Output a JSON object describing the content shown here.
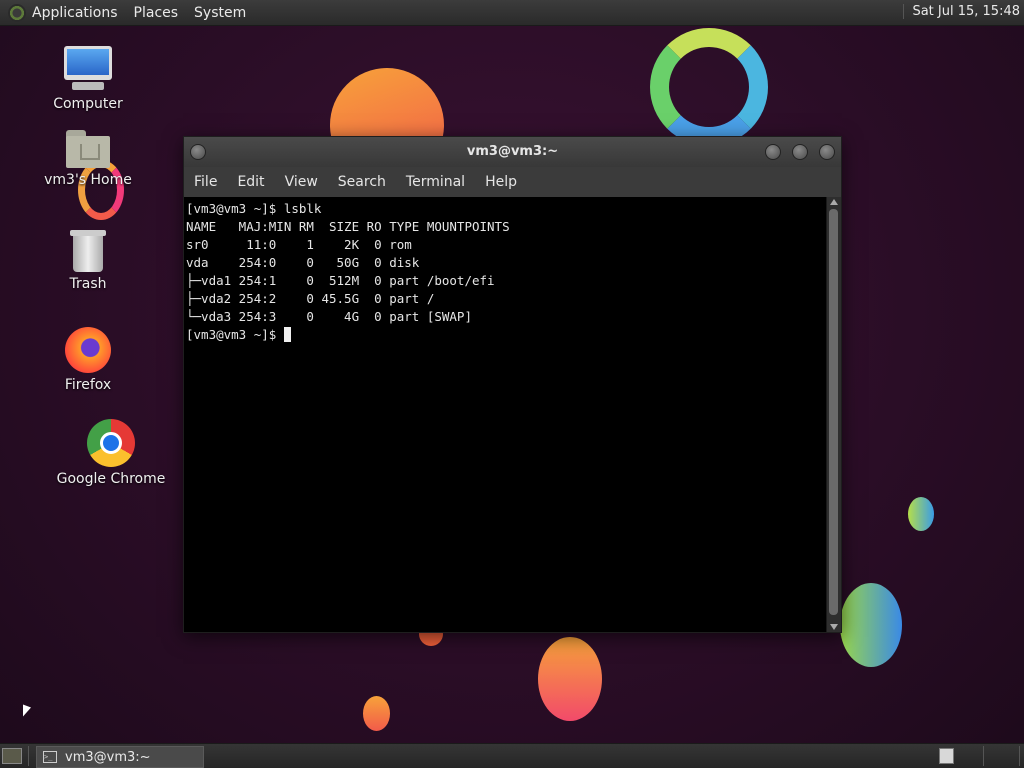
{
  "top_panel": {
    "menus": [
      "Applications",
      "Places",
      "System"
    ],
    "clock": "Sat Jul 15, 15:48"
  },
  "desktop_icons": {
    "computer": "Computer",
    "home": "vm3's Home",
    "trash": "Trash",
    "firefox": "Firefox",
    "chrome": "Google Chrome"
  },
  "terminal_window": {
    "title": "vm3@vm3:~",
    "menus": [
      "File",
      "Edit",
      "View",
      "Search",
      "Terminal",
      "Help"
    ],
    "lines": [
      "[vm3@vm3 ~]$ lsblk",
      "NAME   MAJ:MIN RM  SIZE RO TYPE MOUNTPOINTS",
      "sr0     11:0    1    2K  0 rom",
      "vda    254:0    0   50G  0 disk",
      "├─vda1 254:1    0  512M  0 part /boot/efi",
      "├─vda2 254:2    0 45.5G  0 part /",
      "└─vda3 254:3    0    4G  0 part [SWAP]"
    ],
    "prompt": "[vm3@vm3 ~]$ "
  },
  "taskbar": {
    "task_label": "vm3@vm3:~"
  },
  "colors": {
    "background": "#2a0d26",
    "terminal_bg": "#000000",
    "panel": "#2f2f2f"
  }
}
